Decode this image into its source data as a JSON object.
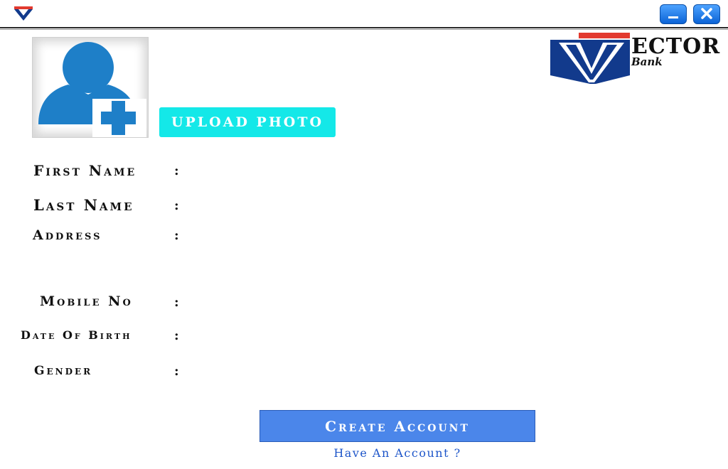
{
  "window": {
    "app_icon": "vector-bank-logo-icon",
    "minimize_icon": "minimize-icon",
    "close_icon": "close-icon",
    "accent_color": "#0b63d6"
  },
  "logo": {
    "word": "ECTOR",
    "sub": "Bank",
    "colors": {
      "blue": "#123a8c",
      "red": "#e23a2f",
      "white": "#ffffff"
    }
  },
  "photo": {
    "icon": "add-user-icon",
    "upload_label": "UPLOAD  PHOTO"
  },
  "form": {
    "fields": [
      {
        "label": "First  Name",
        "colon": ":",
        "value": ""
      },
      {
        "label": "Last  Name",
        "colon": ":",
        "value": ""
      },
      {
        "label": "Address",
        "colon": ":",
        "value": ""
      },
      {
        "label": "Mobile  No",
        "colon": ":",
        "value": ""
      },
      {
        "label": "Date  Of  Birth",
        "colon": ":",
        "value": ""
      },
      {
        "label": "Gender",
        "colon": ":",
        "value": ""
      }
    ]
  },
  "actions": {
    "create_label": "Create  Account",
    "have_account_label": "Have An Account ?"
  }
}
